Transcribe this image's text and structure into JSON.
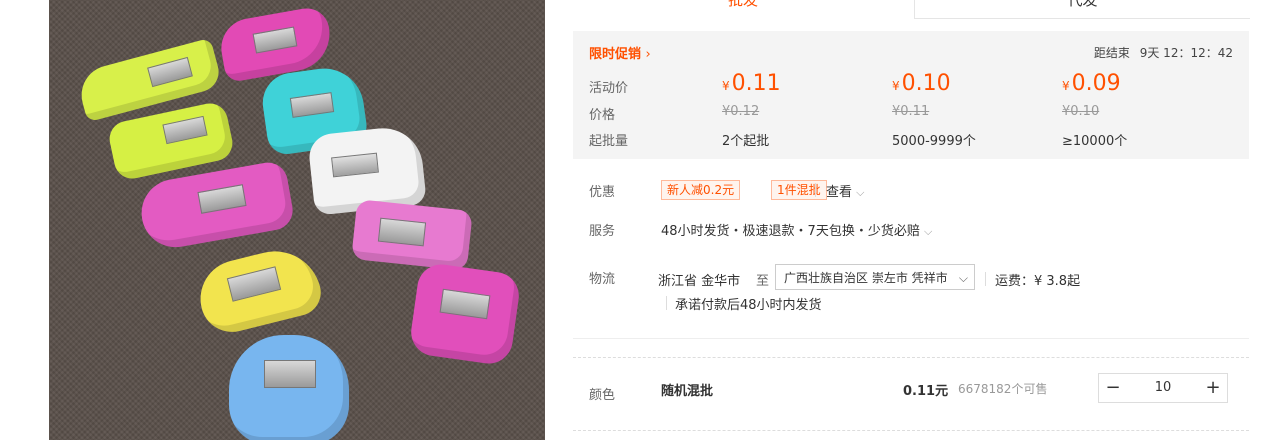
{
  "tabs": {
    "active": "批发",
    "inactive": "代发"
  },
  "promo": {
    "title": "限时促销",
    "countdown_label": "距结束",
    "countdown_value": "9天 12：12：42"
  },
  "price_table": {
    "labels": {
      "activity": "活动价",
      "price": "价格",
      "moq": "起批量"
    },
    "currency": "¥",
    "tiers": [
      {
        "activity": "0.11",
        "original": "¥0.12",
        "qty": "2个起批"
      },
      {
        "activity": "0.10",
        "original": "¥0.11",
        "qty": "5000-9999个"
      },
      {
        "activity": "0.09",
        "original": "¥0.10",
        "qty": "≥10000个"
      }
    ]
  },
  "offers": {
    "label": "优惠",
    "tags": [
      "新人减0.2元",
      "1件混批"
    ],
    "view": "查看"
  },
  "service": {
    "label": "服务",
    "text": "48小时发货・极速退款・7天包换・少货必赔"
  },
  "logistics": {
    "label": "物流",
    "origin": "浙江省 金华市",
    "to": "至",
    "destination": "广西壮族自治区 崇左市 凭祥市",
    "fee": "运费：¥ 3.8起",
    "promise": "承诺付款后48小时内发货"
  },
  "sku": {
    "label": "颜色",
    "name": "随机混批",
    "price": "0.11元",
    "stock": "6678182个可售",
    "quantity": "10",
    "minus": "−",
    "plus": "+"
  },
  "colors": {
    "accent": "#ff5000"
  },
  "icons": {
    "promo_arrow": "chevron-right-icon",
    "dropdown": "chevron-down-icon"
  }
}
